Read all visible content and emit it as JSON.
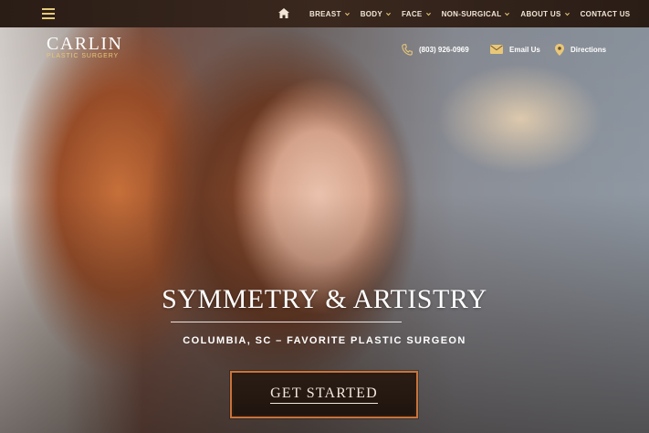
{
  "header": {
    "nav": [
      {
        "label": "BREAST",
        "caret": true
      },
      {
        "label": "BODY",
        "caret": true
      },
      {
        "label": "FACE",
        "caret": true
      },
      {
        "label": "NON-SURGICAL",
        "caret": true
      },
      {
        "label": "ABOUT US",
        "caret": true
      },
      {
        "label": "CONTACT US",
        "caret": false
      }
    ],
    "icons": {
      "menu": "hamburger-menu-icon",
      "home": "home-icon",
      "caret": "chevron-down-icon"
    }
  },
  "logo": {
    "main": "CARLIN",
    "sub": "PLASTIC SURGERY"
  },
  "contact": {
    "phone": "(803) 926-0969",
    "email": "Email Us",
    "directions": "Directions",
    "icons": {
      "phone": "phone-icon",
      "email": "envelope-icon",
      "directions": "map-pin-icon"
    }
  },
  "hero": {
    "headline": "SYMMETRY & ARTISTRY",
    "subline": "COLUMBIA, SC – FAVORITE PLASTIC SURGEON",
    "cta_label": "GET STARTED"
  },
  "colors": {
    "accent_gold": "#e8c779",
    "cta_border": "#c8733b",
    "bar_bg": "#2a1d16"
  }
}
